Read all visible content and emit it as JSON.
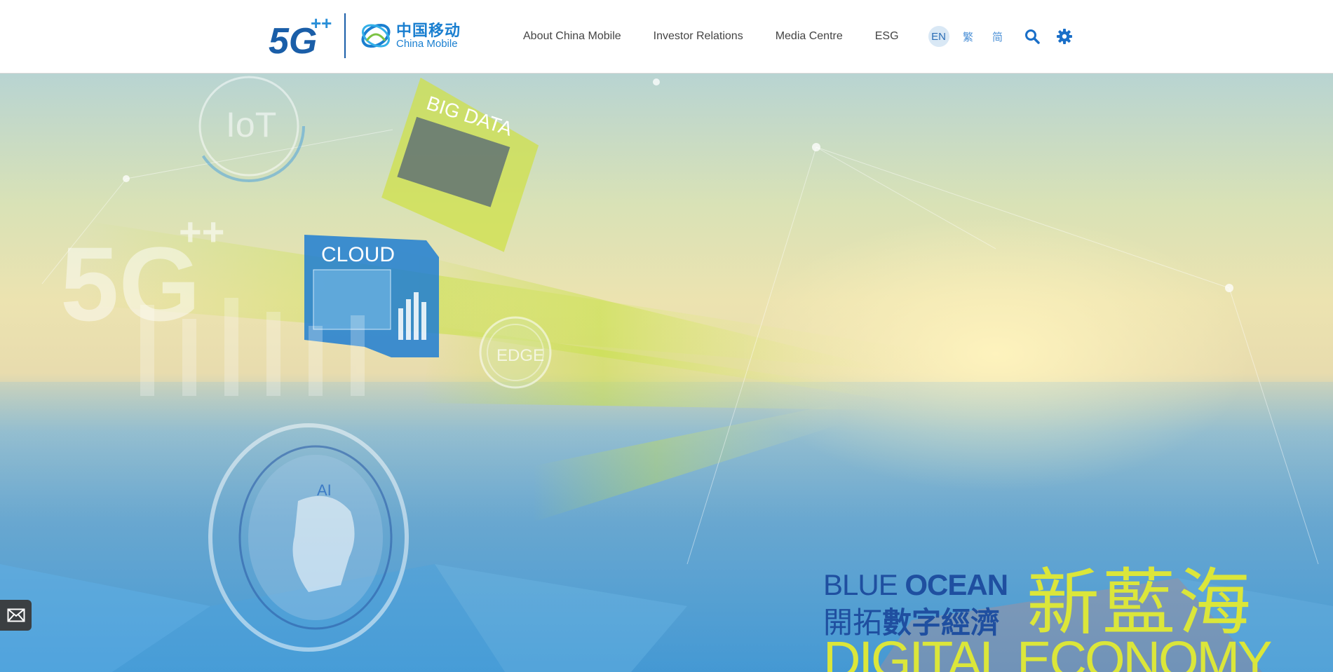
{
  "header": {
    "logo_5g_text": "5G",
    "logo_5g_plus": "++",
    "logo_cm_zh": "中国移动",
    "logo_cm_en": "China Mobile"
  },
  "nav": {
    "items": [
      {
        "label": "About China Mobile"
      },
      {
        "label": "Investor Relations"
      },
      {
        "label": "Media Centre"
      },
      {
        "label": "ESG"
      }
    ]
  },
  "languages": {
    "en": "EN",
    "tc": "繁",
    "sc": "简",
    "active": "EN"
  },
  "tools": {
    "search_icon": "search-icon",
    "settings_icon": "gear-icon"
  },
  "hero": {
    "overlays": {
      "iot": "IoT",
      "big_data": "BIG DATA",
      "cloud": "CLOUD",
      "edge": "EDGE",
      "ai": "AI",
      "five_g": "5G",
      "five_g_plus": "++"
    },
    "slogan": {
      "en1_thin": "BLUE ",
      "en1_bold": "OCEAN",
      "zh1_thin": "開拓",
      "zh1_bold": "數字經濟",
      "zh_big": "新藍海",
      "en2": "DIGITAL ECONOMY"
    }
  },
  "floating": {
    "mail_icon": "mail-icon"
  },
  "colors": {
    "brand_blue": "#1a7fd0",
    "slogan_blue": "#1f4fa0",
    "slogan_yellow": "#dbe63a",
    "nav_text": "#444444"
  }
}
